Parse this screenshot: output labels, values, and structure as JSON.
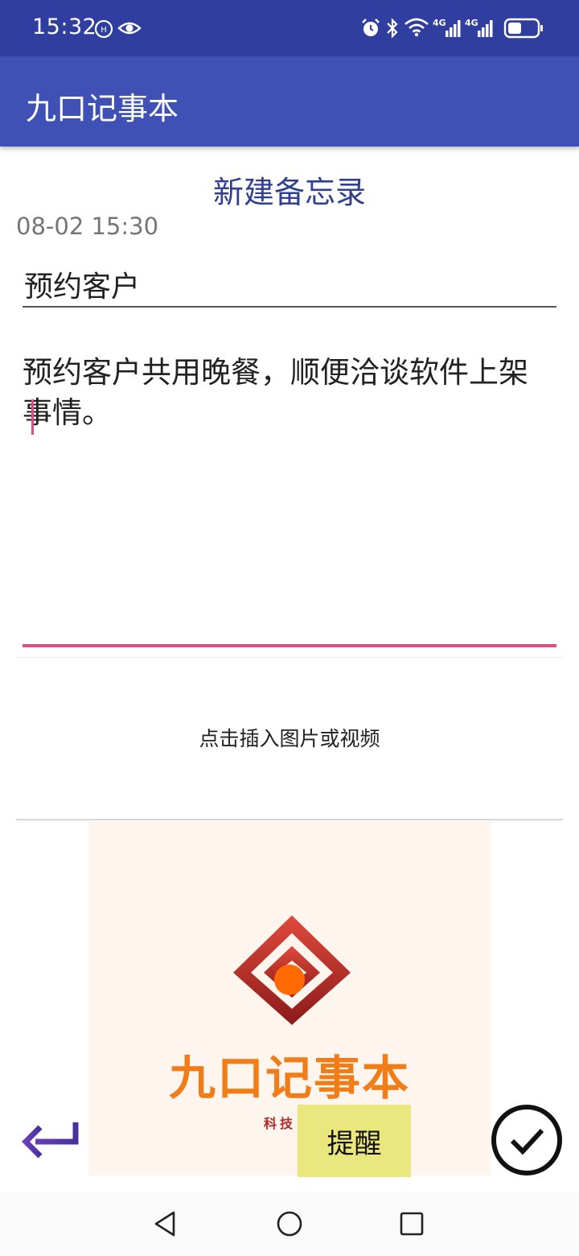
{
  "status_bar": {
    "time": "15:32",
    "icons": [
      "hd-call-icon",
      "eye-icon",
      "alarm-icon",
      "bluetooth-icon",
      "wifi-icon",
      "signal-4g-icon",
      "signal-4g-icon",
      "battery-icon"
    ],
    "network_label_1": "4G",
    "network_label_2": "4G"
  },
  "app_bar": {
    "title": "九口记事本"
  },
  "editor": {
    "heading": "新建备忘录",
    "date": "08-02 15:30",
    "title_value": "预约客户",
    "content": "预约客户共用晚餐，顺便洽谈软件上架事情。"
  },
  "media": {
    "insert_label": "点击插入图片或视频",
    "brand_name": "九口记事本",
    "brand_sub": "科技 有"
  },
  "actions": {
    "back_icon": "back-arrow-icon",
    "remind_label": "提醒",
    "confirm_icon": "check-circle-icon"
  },
  "nav_bar": {
    "icons": [
      "nav-back-icon",
      "nav-home-icon",
      "nav-recents-icon"
    ]
  },
  "colors": {
    "status_bar": "#303f9f",
    "app_bar": "#3f51b5",
    "accent": "#d94f84",
    "remind_button": "#eae77f",
    "brand_orange": "#f07d18",
    "brand_red": "#b22a2a"
  }
}
